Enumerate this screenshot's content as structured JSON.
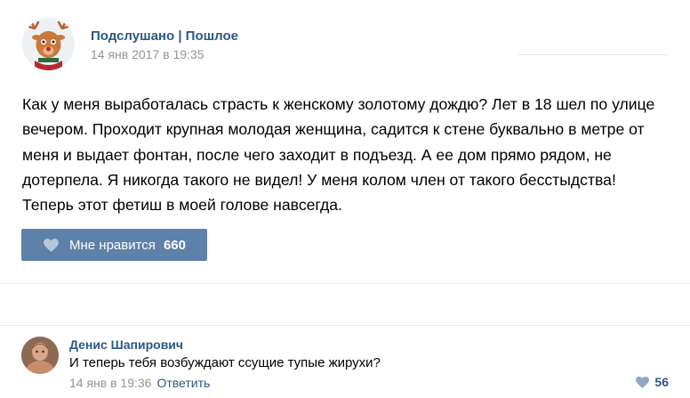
{
  "post": {
    "author": "Подслушано | Пошлое",
    "date": "14 янв 2017 в 19:35",
    "text": "Как у меня выработалась страсть к женскому золотому дождю? Лет в 18 шел по улице вечером. Проходит крупная молодая женщина, садится к стене буквально в метре от меня и выдает фонтан, после чего заходит в подъезд. А ее дом прямо рядом, не дотерпела. Я никогда такого не видел! У меня колом член от такого бесстыдства! Теперь этот фетиш в моей голове навсегда.",
    "like_label": "Мне нравится",
    "like_count": "660"
  },
  "comment": {
    "author": "Денис Шапирович",
    "text": "И теперь тебя возбуждают ссущие тупые жирухи?",
    "date": "14 янв в 19:36",
    "reply_label": "Ответить",
    "like_count": "56"
  },
  "icons": {
    "post_avatar": "reindeer-avatar-icon",
    "like": "heart-icon",
    "comment_like": "heart-icon"
  },
  "colors": {
    "link": "#2a5885",
    "button": "#5d81a8",
    "meta": "#939393"
  }
}
